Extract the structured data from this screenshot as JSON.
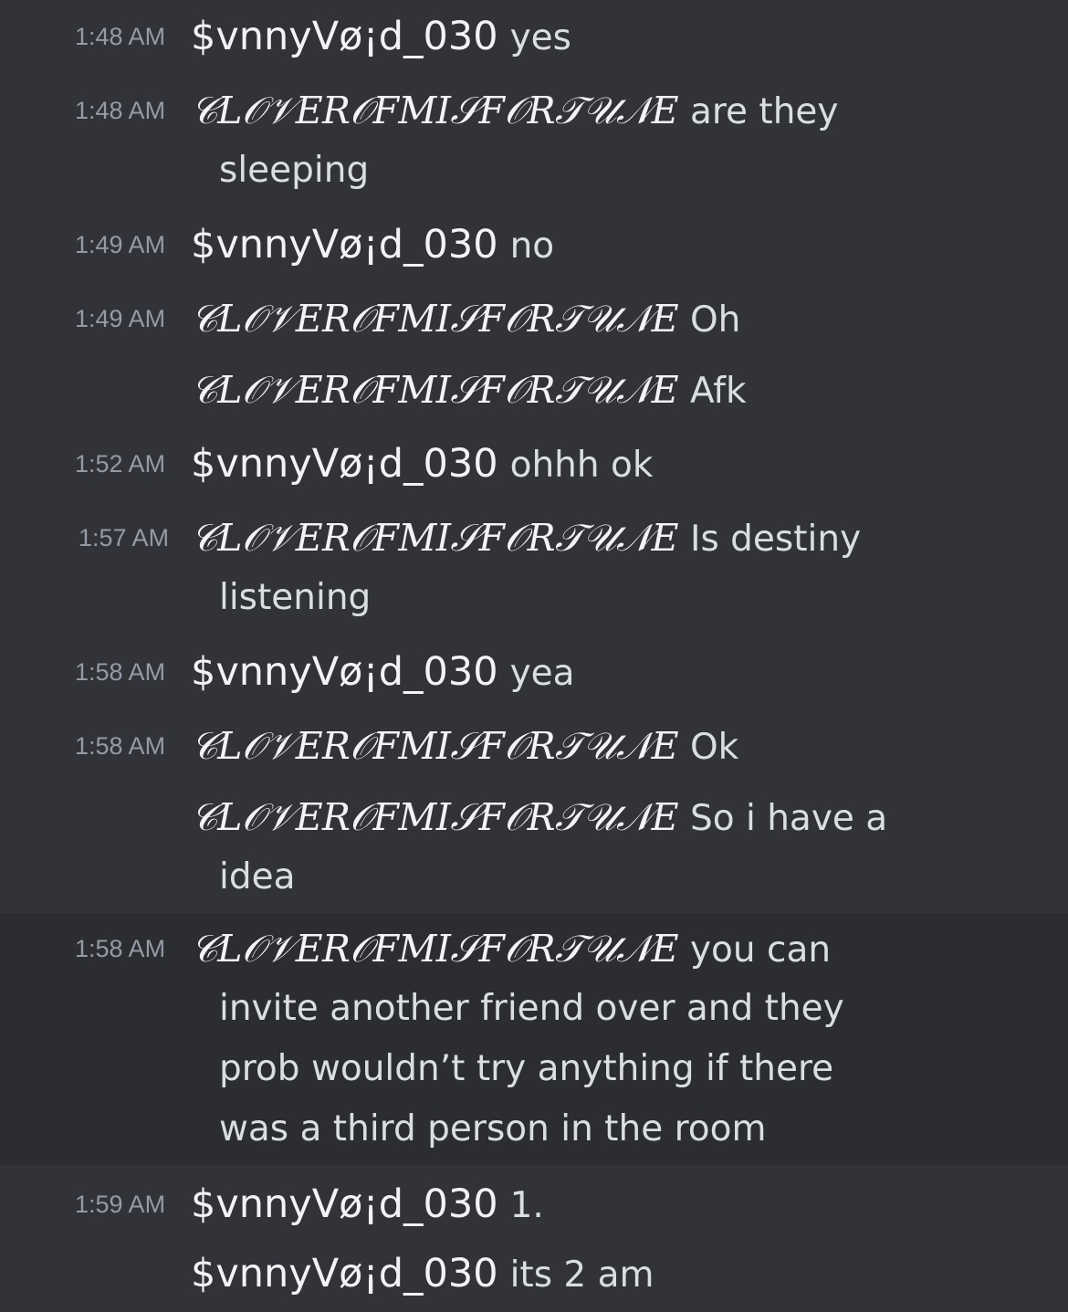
{
  "messages": [
    {
      "time": "1:48 AM",
      "author": "$vnnyVø¡d_030",
      "lines": [
        "yes"
      ]
    },
    {
      "time": "1:48 AM",
      "author": "𝒞𝐿𝒪𝒱𝐸𝑅𝒪𝐹𝑀𝐼𝒮𝐹𝒪𝑅𝒯𝒰𝒩𝐸",
      "lines": [
        "are they",
        "sleeping"
      ]
    },
    {
      "time": "1:49 AM",
      "author": "$vnnyVø¡d_030",
      "lines": [
        "no"
      ]
    },
    {
      "time": "1:49 AM",
      "author": "𝒞𝐿𝒪𝒱𝐸𝑅𝒪𝐹𝑀𝐼𝒮𝐹𝒪𝑅𝒯𝒰𝒩𝐸",
      "lines": [
        "Oh"
      ]
    },
    {
      "time": "",
      "author": "𝒞𝐿𝒪𝒱𝐸𝑅𝒪𝐹𝑀𝐼𝒮𝐹𝒪𝑅𝒯𝒰𝒩𝐸",
      "lines": [
        "Afk"
      ]
    },
    {
      "time": "1:52 AM",
      "author": "$vnnyVø¡d_030",
      "lines": [
        "ohhh ok"
      ]
    },
    {
      "time": "1:57 AM",
      "author": "𝒞𝐿𝒪𝒱𝐸𝑅𝒪𝐹𝑀𝐼𝒮𝐹𝒪𝑅𝒯𝒰𝒩𝐸",
      "lines": [
        "Is destiny",
        "listening"
      ]
    },
    {
      "time": "1:58 AM",
      "author": "$vnnyVø¡d_030",
      "lines": [
        "yea"
      ]
    },
    {
      "time": "1:58 AM",
      "author": "𝒞𝐿𝒪𝒱𝐸𝑅𝒪𝐹𝑀𝐼𝒮𝐹𝒪𝑅𝒯𝒰𝒩𝐸",
      "lines": [
        "Ok"
      ]
    },
    {
      "time": "",
      "author": "𝒞𝐿𝒪𝒱𝐸𝑅𝒪𝐹𝑀𝐼𝒮𝐹𝒪𝑅𝒯𝒰𝒩𝐸",
      "lines": [
        "So i have a",
        "idea"
      ]
    },
    {
      "time": "1:58 AM",
      "author": "𝒞𝐿𝒪𝒱𝐸𝑅𝒪𝐹𝑀𝐼𝒮𝐹𝒪𝑅𝒯𝒰𝒩𝐸",
      "lines": [
        "you can",
        "invite another friend over and they",
        "prob wouldn’t try anything if there",
        "was a third person in the room"
      ]
    },
    {
      "time": "1:59 AM",
      "author": "$vnnyVø¡d_030",
      "lines": [
        "1."
      ]
    },
    {
      "time": "",
      "author": "$vnnyVø¡d_030",
      "lines": [
        "its 2 am"
      ]
    }
  ]
}
